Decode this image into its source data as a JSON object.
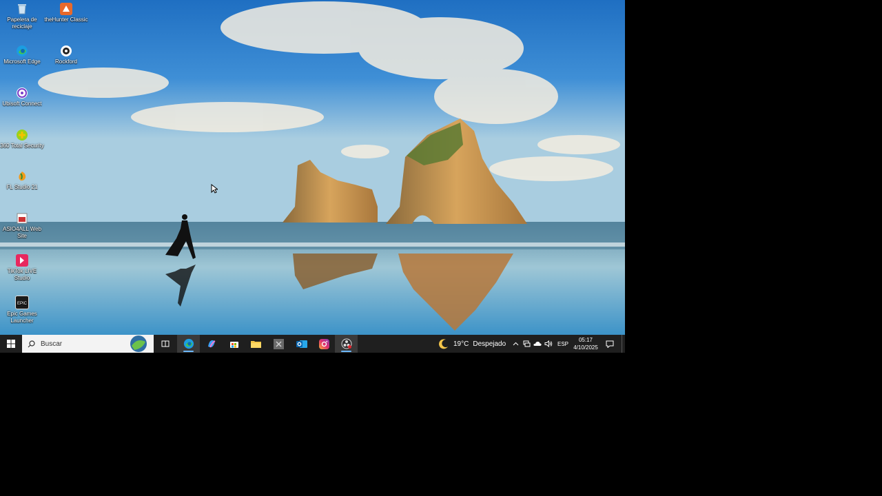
{
  "desktop": {
    "icons": [
      {
        "label": "Papelera de reciclaje",
        "icon": "recycle-bin-icon"
      },
      {
        "label": "theHunter Classic",
        "icon": "thehunter-icon"
      },
      {
        "label": "Microsoft Edge",
        "icon": "edge-icon"
      },
      {
        "label": "Rockford",
        "icon": "rockford-icon"
      },
      {
        "label": "Ubisoft Connect",
        "icon": "ubisoft-icon"
      },
      {
        "label": "360 Total Security",
        "icon": "360-security-icon"
      },
      {
        "label": "FL Studio 21",
        "icon": "fl-studio-icon"
      },
      {
        "label": "ASIO4ALL Web Site",
        "icon": "asio4all-icon"
      },
      {
        "label": "TikTok LIVE Studio",
        "icon": "tiktok-live-icon"
      },
      {
        "label": "Epic Games Launcher",
        "icon": "epic-games-icon"
      }
    ]
  },
  "taskbar": {
    "search_placeholder": "Buscar",
    "pinned": [
      "edge-icon",
      "copilot-icon",
      "store-icon",
      "file-explorer-icon",
      "app-icon",
      "outlook-icon",
      "instagram-icon",
      "obs-icon"
    ],
    "weather": {
      "temp": "19°C",
      "condition": "Despejado"
    },
    "language": "ESP",
    "clock": {
      "time": "05:17",
      "date": "4/10/2025"
    }
  },
  "colors": {
    "taskbar": "#1f1f1f",
    "accent": "#6cb8ff"
  }
}
